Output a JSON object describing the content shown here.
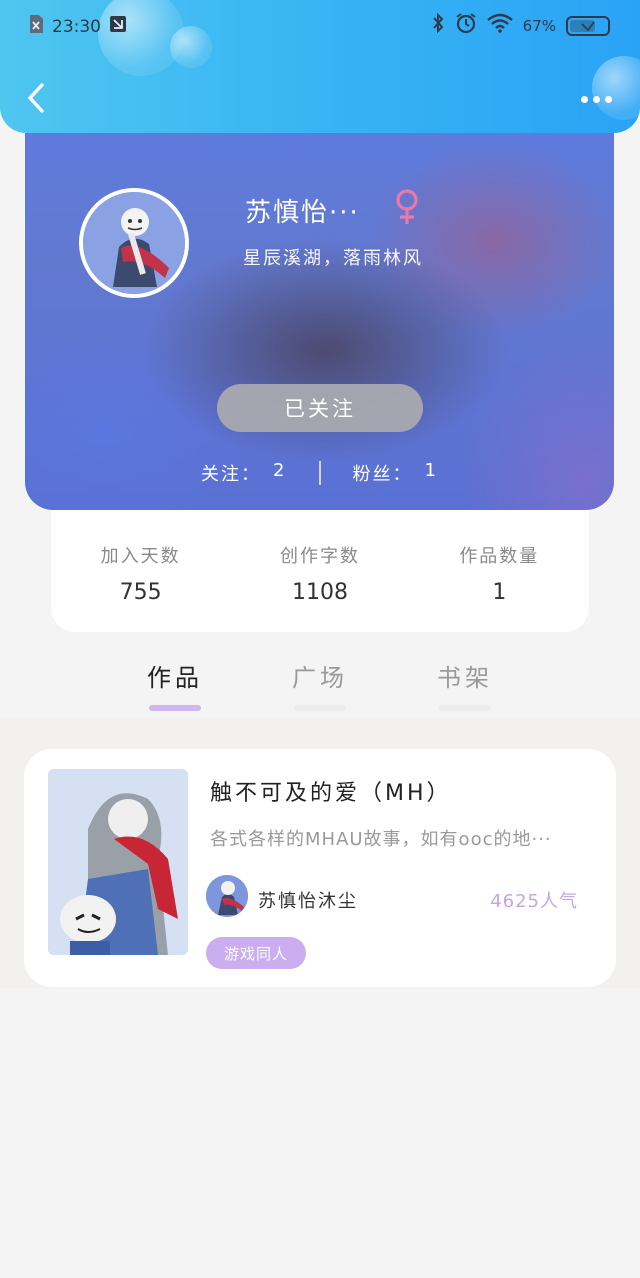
{
  "status_bar": {
    "time": "23:30",
    "battery": "67%"
  },
  "header": {
    "back_icon": "chevron-left-icon",
    "more_icon": "more-dots-icon"
  },
  "profile": {
    "username": "苏慎怡···",
    "gender_symbol": "♀",
    "bio": "星辰溪湖，落雨林风",
    "follow_button": "已关注",
    "following_label": "关注：",
    "following_count": "2",
    "followers_label": "粉丝：",
    "followers_count": "1"
  },
  "stats": [
    {
      "label": "加入天数",
      "value": "755"
    },
    {
      "label": "创作字数",
      "value": "1108"
    },
    {
      "label": "作品数量",
      "value": "1"
    }
  ],
  "tabs": [
    {
      "label": "作品",
      "active": true
    },
    {
      "label": "广场",
      "active": false
    },
    {
      "label": "书架",
      "active": false
    }
  ],
  "work": {
    "title": "触不可及的爱（MH）",
    "description": "各式各样的MHAU故事，如有ooc的地···",
    "author": "苏慎怡沐尘",
    "popularity": "4625人气",
    "tag": "游戏同人"
  },
  "colors": {
    "header": "#36b2f3",
    "accent_purple": "#cfb7ef",
    "gender_pink": "#e97aa8"
  }
}
